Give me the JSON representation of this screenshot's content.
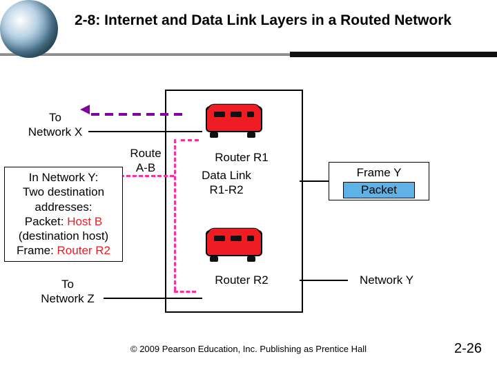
{
  "title": "2-8: Internet and Data Link Layers in a Routed Network",
  "labels": {
    "to_network_x": "To\nNetwork X",
    "to_network_z": "To\nNetwork Z",
    "route_ab": "Route\nA-B",
    "router_r1": "Router R1",
    "router_r2": "Router R2",
    "datalink": "Data Link\nR1-R2",
    "frame_y": "Frame Y",
    "packet": "Packet",
    "network_y": "Network Y"
  },
  "box_y": {
    "l1": "In Network Y:",
    "l2": "Two destination",
    "l3": "addresses:",
    "l4a": "Packet: ",
    "l4b": "Host B",
    "l5": "(destination host)",
    "l6a": "Frame: ",
    "l6b": "Router R2"
  },
  "footer": "© 2009 Pearson Education, Inc.  Publishing as Prentice Hall",
  "pagenum": "2-26"
}
